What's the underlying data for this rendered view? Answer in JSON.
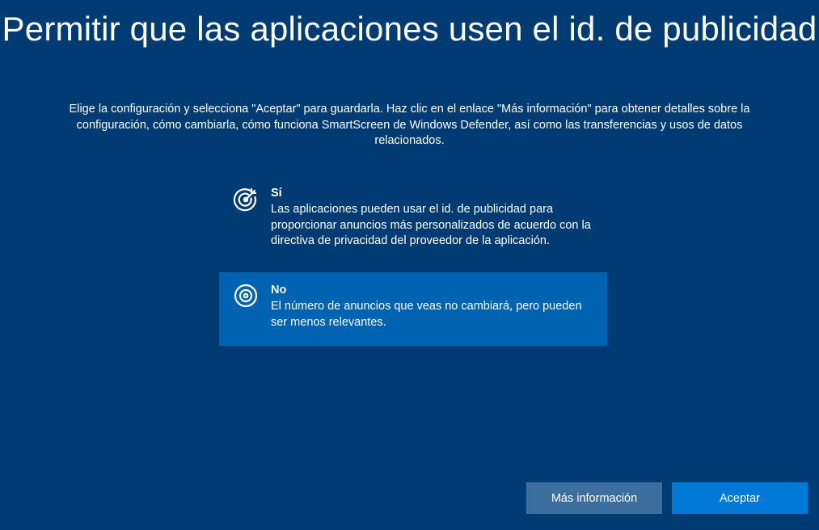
{
  "page": {
    "title": "Permitir que las aplicaciones usen el id. de publicidad",
    "description": "Elige la configuración y selecciona \"Aceptar\" para guardarla. Haz clic en el enlace \"Más información\" para obtener detalles sobre la configuración, cómo cambiarla, cómo funciona SmartScreen de Windows Defender, así como las transferencias y usos de datos relacionados."
  },
  "options": [
    {
      "icon": "target-arrow-icon",
      "title": "Sí",
      "description": "Las aplicaciones pueden usar el id. de publicidad para proporcionar anuncios más personalizados de acuerdo con la directiva de privacidad del proveedor de la aplicación.",
      "selected": false
    },
    {
      "icon": "target-icon",
      "title": "No",
      "description": "El número de anuncios que veas no cambiará, pero pueden ser menos relevantes.",
      "selected": true
    }
  ],
  "buttons": {
    "more_info": "Más información",
    "accept": "Aceptar"
  },
  "colors": {
    "background": "#003c73",
    "selected_option": "#0063b1",
    "secondary_button": "#3c6ea0",
    "primary_button": "#0078d7"
  }
}
